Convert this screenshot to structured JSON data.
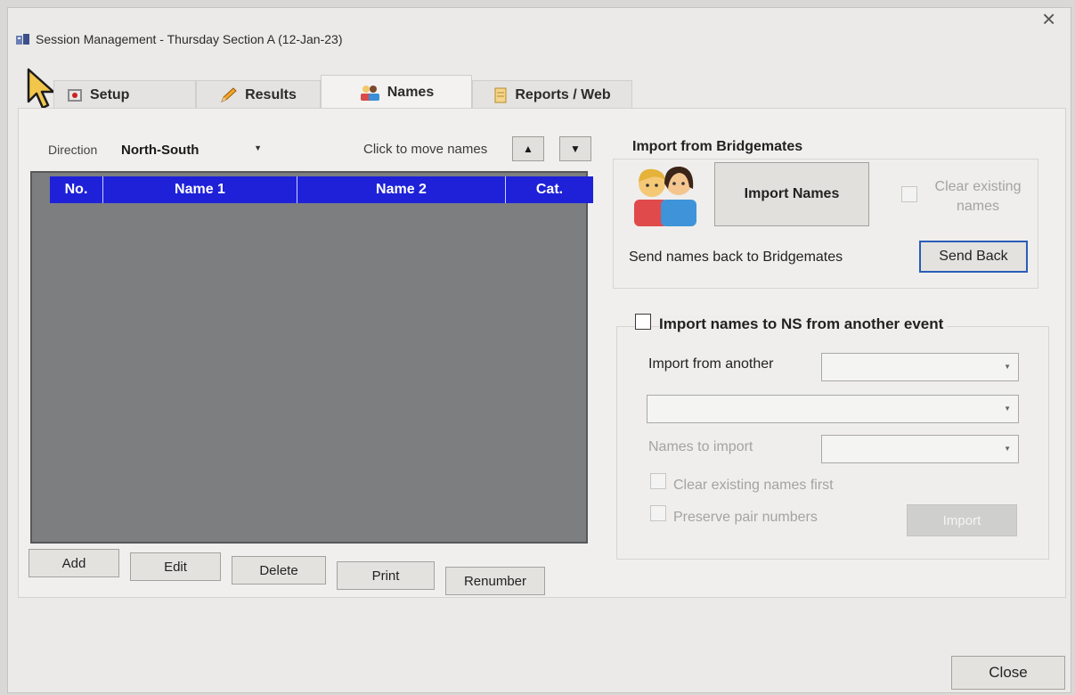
{
  "window": {
    "title": "Session Management - Thursday Section A (12-Jan-23)",
    "close_glyph": "×"
  },
  "tabs": [
    {
      "label": "Setup",
      "icon": "setup-icon",
      "active": false
    },
    {
      "label": "Results",
      "icon": "pencil-icon",
      "active": false
    },
    {
      "label": "Names",
      "icon": "people-icon",
      "active": true
    },
    {
      "label": "Reports / Web",
      "icon": "report-icon",
      "active": false
    }
  ],
  "names_panel": {
    "direction_label": "Direction",
    "direction_value": "North-South",
    "move_label": "Click to move names",
    "up_glyph": "▲",
    "down_glyph": "▼",
    "columns": [
      "No.",
      "Name 1",
      "Name 2",
      "Cat."
    ],
    "rows": [],
    "buttons": {
      "add": "Add",
      "edit": "Edit",
      "delete": "Delete",
      "print": "Print",
      "renumber": "Renumber"
    }
  },
  "bridgemates": {
    "title": "Import from Bridgemates",
    "import_button": "Import Names",
    "clear_label": "Clear existing names",
    "clear_checked": false,
    "send_back_text": "Send names back to Bridgemates",
    "send_back_button": "Send Back"
  },
  "import_event": {
    "checkbox_label": "Import names to NS from another event",
    "checked": false,
    "from_label": "Import from another",
    "names_label": "Names to import",
    "clear_first_label": "Clear existing names first",
    "preserve_label": "Preserve pair numbers",
    "import_button": "Import"
  },
  "footer": {
    "close_button": "Close"
  },
  "colors": {
    "grid_header": "#1e21d8",
    "grid_body": "#7d7e80",
    "send_back_border": "#2a5db8"
  }
}
